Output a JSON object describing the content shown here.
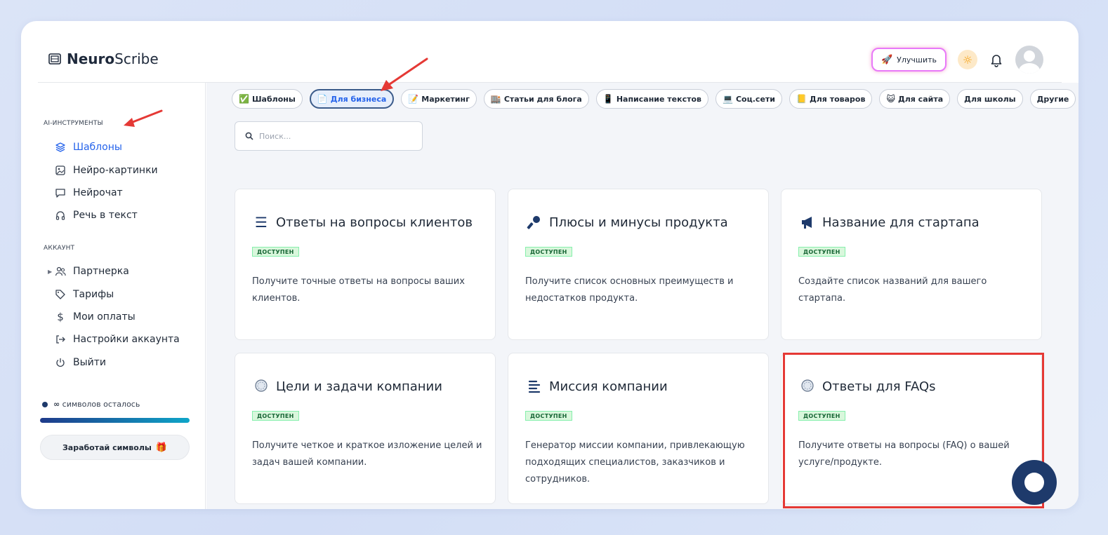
{
  "header": {
    "logo_bold": "Neuro",
    "logo_regular": "Scribe",
    "upgrade_label": "Улучшить"
  },
  "sidebar": {
    "ai_section_title": "AI-ИНСТРУМЕНТЫ",
    "ai_items": [
      {
        "label": "Шаблоны",
        "icon": "layers-icon",
        "active": true
      },
      {
        "label": "Нейро-картинки",
        "icon": "image-icon"
      },
      {
        "label": "Нейрочат",
        "icon": "chat-icon"
      },
      {
        "label": "Речь в текст",
        "icon": "headphones-icon"
      }
    ],
    "account_section_title": "АККАУНТ",
    "account_items": [
      {
        "label": "Партнерка",
        "icon": "users-icon"
      },
      {
        "label": "Тарифы",
        "icon": "tag-icon"
      },
      {
        "label": "Мои оплаты",
        "icon": "dollar-icon"
      },
      {
        "label": "Настройки аккаунта",
        "icon": "login-icon"
      },
      {
        "label": "Выйти",
        "icon": "power-icon"
      }
    ],
    "symbols_infinity": "∞",
    "symbols_text": "символов осталось",
    "earn_label": "Заработай символы"
  },
  "tabs": [
    {
      "label": "Шаблоны",
      "icon": "✅"
    },
    {
      "label": "Для бизнеса",
      "icon": "📄",
      "active": true
    },
    {
      "label": "Маркетинг",
      "icon": "📝"
    },
    {
      "label": "Статьи для блога",
      "icon": "🏬"
    },
    {
      "label": "Написание текстов",
      "icon": "📱"
    },
    {
      "label": "Соц.сети",
      "icon": "💻"
    },
    {
      "label": "Для товаров",
      "icon": "📒"
    },
    {
      "label": "Для сайта",
      "icon": "😺"
    },
    {
      "label": "Для школы",
      "icon": ""
    },
    {
      "label": "Другие",
      "icon": ""
    }
  ],
  "search": {
    "placeholder": "Поиск..."
  },
  "badge_label": "ДОСТУПЕН",
  "cards": [
    {
      "title": "Ответы на вопросы клиентов",
      "icon": "list-icon",
      "desc": "Получите точные ответы на вопросы ваших клиентов."
    },
    {
      "title": "Плюсы и минусы продукта",
      "icon": "key-icon",
      "desc": "Получите список основных преимуществ и недостатков продукта."
    },
    {
      "title": "Название для стартапа",
      "icon": "megaphone-icon",
      "desc": "Создайте список названий для вашего стартапа."
    },
    {
      "title": "Цели и задачи компании",
      "icon": "badge-icon",
      "desc": "Получите четкое и краткое изложение целей и задач вашей компании."
    },
    {
      "title": "Миссия компании",
      "icon": "align-left-icon",
      "desc": "Генератор миссии компании, привлекающую подходящих специалистов, заказчиков и сотрудников."
    },
    {
      "title": "Ответы для FAQs",
      "icon": "badge-icon",
      "desc": "Получите ответы на вопросы (FAQ) о вашей услуге/продукте."
    }
  ],
  "colors": {
    "accent": "#2563eb",
    "brand_dark": "#1e3a6b",
    "annotation_red": "#e53935",
    "badge_bg": "#d9f7dc"
  }
}
